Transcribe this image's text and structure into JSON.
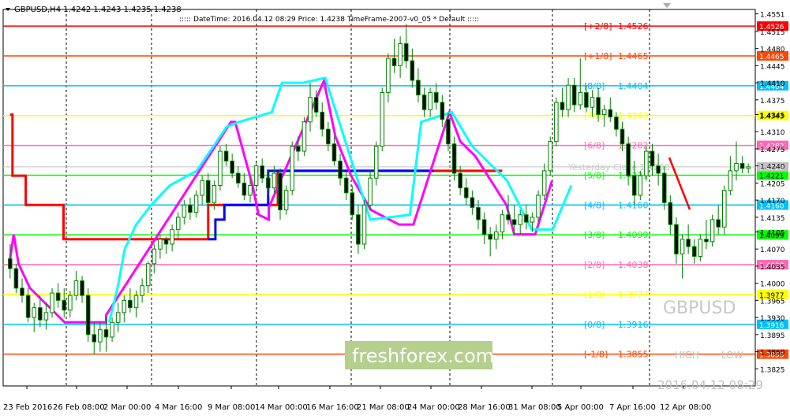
{
  "header": {
    "symbol_line": "GBPUSD,H4  1.4242 1.4243 1.4235 1.4238",
    "info_line": "::::: DateTime: 2016.04.12 08:29   Price: 1.4238   TimeFrame-2007-v0_05    *   Default   :::::"
  },
  "watermark": {
    "symbol": "GBPUSD",
    "brand": "freshforex.com",
    "high_label": "HIGH",
    "low_label": "LOW",
    "timestamp": "2016.04.12 08:29"
  },
  "colors": {
    "candle": "#008000",
    "background": "#ffffff",
    "red_line": "#ff0000",
    "magenta_line": "#ff00ff",
    "cyan_line": "#00ffff",
    "blue_line": "#0000ff",
    "grid": "#000000"
  },
  "chart_data": {
    "type": "candlestick",
    "symbol": "GBPUSD",
    "timeframe": "H4",
    "ylim": [
      1.379,
      1.456
    ],
    "y_ticks": [
      "1.4551",
      "1.4515",
      "1.4480",
      "1.4445",
      "1.4410",
      "1.4375",
      "1.4345",
      "1.4310",
      "1.4275",
      "1.4240",
      "1.4205",
      "1.4170",
      "1.4135",
      "1.4105",
      "1.4070",
      "1.4035",
      "1.4000",
      "1.3965",
      "1.3930",
      "1.3895",
      "1.3860",
      "1.3825"
    ],
    "x_ticks": [
      "23 Feb 2016",
      "26 Feb 08:00",
      "2 Mar 00:00",
      "4 Mar 16:00",
      "9 Mar 08:00",
      "14 Mar 00:00",
      "16 Mar 16:00",
      "21 Mar 08:00",
      "24 Mar 00:00",
      "28 Mar 16:00",
      "31 Mar 08:00",
      "5 Apr 00:00",
      "7 Apr 16:00",
      "12 Apr 08:00"
    ],
    "last_price": {
      "label": "1.4238",
      "value": 1.4238
    },
    "murrey_levels": [
      {
        "name": "[+2/8]",
        "value": 1.4526,
        "label": "1.4526",
        "color": "#ff0000"
      },
      {
        "name": "[+1/8]",
        "value": 1.4465,
        "label": "1.4465",
        "color": "#ff4500"
      },
      {
        "name": "[8/8]",
        "value": 1.4404,
        "label": "1.4404",
        "color": "#00bfff"
      },
      {
        "name": "[7/8]",
        "value": 1.4343,
        "label": "1.4343",
        "color": "#ffff00"
      },
      {
        "name": "[6/8]",
        "value": 1.4282,
        "label": "1.4282",
        "color": "#ff69b4"
      },
      {
        "name": "[5/8]",
        "value": 1.4221,
        "label": "1.4221",
        "color": "#00ff00"
      },
      {
        "name": "[4/8]",
        "value": 1.416,
        "label": "1.4160",
        "color": "#00bfff"
      },
      {
        "name": "[3/8]",
        "value": 1.4099,
        "label": "1.4099",
        "color": "#00ff00"
      },
      {
        "name": "[2/8]",
        "value": 1.4038,
        "label": "1.4038",
        "color": "#ff69b4"
      },
      {
        "name": "[1/8]",
        "value": 1.3977,
        "label": "1.3977",
        "color": "#ffff00"
      },
      {
        "name": "[0/8]",
        "value": 1.3916,
        "label": "1.3916",
        "color": "#00bfff"
      },
      {
        "name": "[-1/8]",
        "value": 1.3855,
        "label": "1.3855",
        "color": "#ff4500"
      }
    ],
    "yesterday_close_label": "Yesterday Close 1.4238",
    "candles": [
      {
        "o": 1.405,
        "h": 1.408,
        "l": 1.401,
        "c": 1.403
      },
      {
        "o": 1.403,
        "h": 1.404,
        "l": 1.398,
        "c": 1.399
      },
      {
        "o": 1.399,
        "h": 1.401,
        "l": 1.396,
        "c": 1.3975
      },
      {
        "o": 1.3975,
        "h": 1.399,
        "l": 1.392,
        "c": 1.393
      },
      {
        "o": 1.393,
        "h": 1.396,
        "l": 1.39,
        "c": 1.395
      },
      {
        "o": 1.395,
        "h": 1.3975,
        "l": 1.391,
        "c": 1.3925
      },
      {
        "o": 1.3925,
        "h": 1.396,
        "l": 1.3905,
        "c": 1.394
      },
      {
        "o": 1.394,
        "h": 1.399,
        "l": 1.393,
        "c": 1.398
      },
      {
        "o": 1.398,
        "h": 1.4,
        "l": 1.395,
        "c": 1.3965
      },
      {
        "o": 1.3965,
        "h": 1.399,
        "l": 1.393,
        "c": 1.3945
      },
      {
        "o": 1.3945,
        "h": 1.3985,
        "l": 1.393,
        "c": 1.3975
      },
      {
        "o": 1.3975,
        "h": 1.4025,
        "l": 1.3965,
        "c": 1.4005
      },
      {
        "o": 1.4005,
        "h": 1.4015,
        "l": 1.396,
        "c": 1.3975
      },
      {
        "o": 1.3975,
        "h": 1.399,
        "l": 1.388,
        "c": 1.3895
      },
      {
        "o": 1.3895,
        "h": 1.392,
        "l": 1.3855,
        "c": 1.388
      },
      {
        "o": 1.388,
        "h": 1.392,
        "l": 1.386,
        "c": 1.3905
      },
      {
        "o": 1.3905,
        "h": 1.393,
        "l": 1.386,
        "c": 1.389
      },
      {
        "o": 1.389,
        "h": 1.393,
        "l": 1.388,
        "c": 1.392
      },
      {
        "o": 1.392,
        "h": 1.396,
        "l": 1.39,
        "c": 1.394
      },
      {
        "o": 1.394,
        "h": 1.3975,
        "l": 1.392,
        "c": 1.3965
      },
      {
        "o": 1.3965,
        "h": 1.399,
        "l": 1.394,
        "c": 1.395
      },
      {
        "o": 1.395,
        "h": 1.3985,
        "l": 1.393,
        "c": 1.3975
      },
      {
        "o": 1.3975,
        "h": 1.401,
        "l": 1.396,
        "c": 1.3995
      },
      {
        "o": 1.3995,
        "h": 1.4045,
        "l": 1.398,
        "c": 1.404
      },
      {
        "o": 1.404,
        "h": 1.408,
        "l": 1.402,
        "c": 1.407
      },
      {
        "o": 1.407,
        "h": 1.41,
        "l": 1.405,
        "c": 1.409
      },
      {
        "o": 1.409,
        "h": 1.4095,
        "l": 1.406,
        "c": 1.408
      },
      {
        "o": 1.408,
        "h": 1.412,
        "l": 1.4065,
        "c": 1.411
      },
      {
        "o": 1.411,
        "h": 1.4145,
        "l": 1.409,
        "c": 1.4135
      },
      {
        "o": 1.4135,
        "h": 1.417,
        "l": 1.412,
        "c": 1.416
      },
      {
        "o": 1.416,
        "h": 1.4175,
        "l": 1.413,
        "c": 1.4145
      },
      {
        "o": 1.4145,
        "h": 1.419,
        "l": 1.4135,
        "c": 1.418
      },
      {
        "o": 1.418,
        "h": 1.422,
        "l": 1.416,
        "c": 1.421
      },
      {
        "o": 1.421,
        "h": 1.4225,
        "l": 1.415,
        "c": 1.4165
      },
      {
        "o": 1.4165,
        "h": 1.421,
        "l": 1.415,
        "c": 1.42
      },
      {
        "o": 1.42,
        "h": 1.428,
        "l": 1.419,
        "c": 1.427
      },
      {
        "o": 1.427,
        "h": 1.4285,
        "l": 1.424,
        "c": 1.425
      },
      {
        "o": 1.425,
        "h": 1.4265,
        "l": 1.4215,
        "c": 1.4225
      },
      {
        "o": 1.4225,
        "h": 1.424,
        "l": 1.4195,
        "c": 1.4205
      },
      {
        "o": 1.4205,
        "h": 1.4225,
        "l": 1.417,
        "c": 1.418
      },
      {
        "o": 1.418,
        "h": 1.4215,
        "l": 1.4165,
        "c": 1.42
      },
      {
        "o": 1.42,
        "h": 1.425,
        "l": 1.419,
        "c": 1.424
      },
      {
        "o": 1.424,
        "h": 1.4255,
        "l": 1.4205,
        "c": 1.4215
      },
      {
        "o": 1.4215,
        "h": 1.423,
        "l": 1.418,
        "c": 1.4195
      },
      {
        "o": 1.4195,
        "h": 1.424,
        "l": 1.4185,
        "c": 1.4225
      },
      {
        "o": 1.4225,
        "h": 1.4235,
        "l": 1.413,
        "c": 1.415
      },
      {
        "o": 1.415,
        "h": 1.42,
        "l": 1.414,
        "c": 1.419
      },
      {
        "o": 1.419,
        "h": 1.429,
        "l": 1.418,
        "c": 1.428
      },
      {
        "o": 1.428,
        "h": 1.43,
        "l": 1.425,
        "c": 1.427
      },
      {
        "o": 1.427,
        "h": 1.434,
        "l": 1.426,
        "c": 1.433
      },
      {
        "o": 1.433,
        "h": 1.441,
        "l": 1.431,
        "c": 1.438
      },
      {
        "o": 1.438,
        "h": 1.4395,
        "l": 1.434,
        "c": 1.435
      },
      {
        "o": 1.435,
        "h": 1.437,
        "l": 1.43,
        "c": 1.4315
      },
      {
        "o": 1.4315,
        "h": 1.433,
        "l": 1.427,
        "c": 1.4285
      },
      {
        "o": 1.4285,
        "h": 1.43,
        "l": 1.424,
        "c": 1.425
      },
      {
        "o": 1.425,
        "h": 1.4265,
        "l": 1.42,
        "c": 1.4215
      },
      {
        "o": 1.4215,
        "h": 1.423,
        "l": 1.417,
        "c": 1.4185
      },
      {
        "o": 1.4185,
        "h": 1.42,
        "l": 1.413,
        "c": 1.414
      },
      {
        "o": 1.414,
        "h": 1.416,
        "l": 1.406,
        "c": 1.408
      },
      {
        "o": 1.408,
        "h": 1.417,
        "l": 1.407,
        "c": 1.416
      },
      {
        "o": 1.416,
        "h": 1.423,
        "l": 1.415,
        "c": 1.4215
      },
      {
        "o": 1.4215,
        "h": 1.429,
        "l": 1.42,
        "c": 1.428
      },
      {
        "o": 1.428,
        "h": 1.44,
        "l": 1.427,
        "c": 1.439
      },
      {
        "o": 1.439,
        "h": 1.447,
        "l": 1.437,
        "c": 1.446
      },
      {
        "o": 1.446,
        "h": 1.45,
        "l": 1.443,
        "c": 1.4445
      },
      {
        "o": 1.4445,
        "h": 1.4505,
        "l": 1.442,
        "c": 1.449
      },
      {
        "o": 1.449,
        "h": 1.453,
        "l": 1.444,
        "c": 1.4455
      },
      {
        "o": 1.4455,
        "h": 1.448,
        "l": 1.44,
        "c": 1.4415
      },
      {
        "o": 1.4415,
        "h": 1.444,
        "l": 1.437,
        "c": 1.4385
      },
      {
        "o": 1.4385,
        "h": 1.44,
        "l": 1.434,
        "c": 1.4355
      },
      {
        "o": 1.4355,
        "h": 1.44,
        "l": 1.434,
        "c": 1.439
      },
      {
        "o": 1.439,
        "h": 1.441,
        "l": 1.4355,
        "c": 1.437
      },
      {
        "o": 1.437,
        "h": 1.4385,
        "l": 1.432,
        "c": 1.4335
      },
      {
        "o": 1.4335,
        "h": 1.435,
        "l": 1.427,
        "c": 1.4285
      },
      {
        "o": 1.4285,
        "h": 1.43,
        "l": 1.421,
        "c": 1.4225
      },
      {
        "o": 1.4225,
        "h": 1.424,
        "l": 1.418,
        "c": 1.4195
      },
      {
        "o": 1.4195,
        "h": 1.4215,
        "l": 1.416,
        "c": 1.4175
      },
      {
        "o": 1.4175,
        "h": 1.419,
        "l": 1.414,
        "c": 1.4155
      },
      {
        "o": 1.4155,
        "h": 1.417,
        "l": 1.411,
        "c": 1.413
      },
      {
        "o": 1.413,
        "h": 1.4145,
        "l": 1.408,
        "c": 1.41
      },
      {
        "o": 1.41,
        "h": 1.4115,
        "l": 1.4055,
        "c": 1.409
      },
      {
        "o": 1.409,
        "h": 1.412,
        "l": 1.407,
        "c": 1.4105
      },
      {
        "o": 1.4105,
        "h": 1.415,
        "l": 1.409,
        "c": 1.414
      },
      {
        "o": 1.414,
        "h": 1.418,
        "l": 1.412,
        "c": 1.413
      },
      {
        "o": 1.413,
        "h": 1.416,
        "l": 1.41,
        "c": 1.412
      },
      {
        "o": 1.412,
        "h": 1.415,
        "l": 1.41,
        "c": 1.414
      },
      {
        "o": 1.414,
        "h": 1.416,
        "l": 1.411,
        "c": 1.4125
      },
      {
        "o": 1.4125,
        "h": 1.4145,
        "l": 1.4105,
        "c": 1.4135
      },
      {
        "o": 1.4135,
        "h": 1.419,
        "l": 1.4125,
        "c": 1.418
      },
      {
        "o": 1.418,
        "h": 1.4245,
        "l": 1.417,
        "c": 1.423
      },
      {
        "o": 1.423,
        "h": 1.43,
        "l": 1.422,
        "c": 1.429
      },
      {
        "o": 1.429,
        "h": 1.438,
        "l": 1.428,
        "c": 1.437
      },
      {
        "o": 1.437,
        "h": 1.44,
        "l": 1.434,
        "c": 1.4355
      },
      {
        "o": 1.4355,
        "h": 1.442,
        "l": 1.434,
        "c": 1.4405
      },
      {
        "o": 1.4405,
        "h": 1.442,
        "l": 1.435,
        "c": 1.4365
      },
      {
        "o": 1.4365,
        "h": 1.446,
        "l": 1.4355,
        "c": 1.439
      },
      {
        "o": 1.439,
        "h": 1.4405,
        "l": 1.435,
        "c": 1.436
      },
      {
        "o": 1.436,
        "h": 1.4395,
        "l": 1.434,
        "c": 1.438
      },
      {
        "o": 1.438,
        "h": 1.44,
        "l": 1.433,
        "c": 1.4345
      },
      {
        "o": 1.4345,
        "h": 1.4365,
        "l": 1.432,
        "c": 1.4355
      },
      {
        "o": 1.4355,
        "h": 1.438,
        "l": 1.433,
        "c": 1.434
      },
      {
        "o": 1.434,
        "h": 1.435,
        "l": 1.43,
        "c": 1.4315
      },
      {
        "o": 1.4315,
        "h": 1.433,
        "l": 1.427,
        "c": 1.4285
      },
      {
        "o": 1.4285,
        "h": 1.43,
        "l": 1.42,
        "c": 1.422
      },
      {
        "o": 1.422,
        "h": 1.425,
        "l": 1.416,
        "c": 1.418
      },
      {
        "o": 1.418,
        "h": 1.423,
        "l": 1.417,
        "c": 1.422
      },
      {
        "o": 1.422,
        "h": 1.428,
        "l": 1.421,
        "c": 1.427
      },
      {
        "o": 1.427,
        "h": 1.4285,
        "l": 1.422,
        "c": 1.424
      },
      {
        "o": 1.424,
        "h": 1.4265,
        "l": 1.42,
        "c": 1.4225
      },
      {
        "o": 1.4225,
        "h": 1.424,
        "l": 1.415,
        "c": 1.4165
      },
      {
        "o": 1.4165,
        "h": 1.418,
        "l": 1.41,
        "c": 1.412
      },
      {
        "o": 1.412,
        "h": 1.4135,
        "l": 1.404,
        "c": 1.406
      },
      {
        "o": 1.406,
        "h": 1.41,
        "l": 1.401,
        "c": 1.409
      },
      {
        "o": 1.409,
        "h": 1.412,
        "l": 1.406,
        "c": 1.4075
      },
      {
        "o": 1.4075,
        "h": 1.409,
        "l": 1.404,
        "c": 1.4055
      },
      {
        "o": 1.4055,
        "h": 1.41,
        "l": 1.4045,
        "c": 1.409
      },
      {
        "o": 1.409,
        "h": 1.413,
        "l": 1.407,
        "c": 1.4085
      },
      {
        "o": 1.4085,
        "h": 1.414,
        "l": 1.4075,
        "c": 1.413
      },
      {
        "o": 1.413,
        "h": 1.416,
        "l": 1.41,
        "c": 1.4115
      },
      {
        "o": 1.4115,
        "h": 1.42,
        "l": 1.41,
        "c": 1.419
      },
      {
        "o": 1.419,
        "h": 1.426,
        "l": 1.418,
        "c": 1.423
      },
      {
        "o": 1.423,
        "h": 1.429,
        "l": 1.421,
        "c": 1.4245
      },
      {
        "o": 1.4245,
        "h": 1.426,
        "l": 1.4225,
        "c": 1.4235
      },
      {
        "o": 1.4235,
        "h": 1.4245,
        "l": 1.4225,
        "c": 1.4238
      }
    ]
  },
  "_overlay": {
    "red_steps": [
      [
        0,
        1.4345
      ],
      [
        0.4,
        1.4345
      ],
      [
        0.4,
        1.422
      ],
      [
        2.6,
        1.422
      ],
      [
        2.6,
        1.416
      ],
      [
        8.9,
        1.416
      ],
      [
        8.9,
        1.409
      ],
      [
        33.0,
        1.409
      ],
      [
        33.0,
        1.416
      ],
      [
        44.6,
        1.416
      ],
      [
        44.6,
        1.423
      ],
      [
        50.3,
        1.423
      ],
      [
        50.3,
        1.423
      ],
      [
        82.0,
        1.423
      ]
    ],
    "blue_steps": [
      [
        33.0,
        1.409
      ],
      [
        34.2,
        1.409
      ],
      [
        34.2,
        1.413
      ],
      [
        35.7,
        1.413
      ],
      [
        35.7,
        1.416
      ],
      [
        43.0,
        1.416
      ],
      [
        43.0,
        1.423
      ],
      [
        45.8,
        1.423
      ],
      [
        66.0,
        1.423
      ],
      [
        70.6,
        1.423
      ]
    ],
    "magenta_steps": [
      [
        0.0,
        1.405
      ],
      [
        0.6,
        1.41
      ],
      [
        1.4,
        1.404
      ],
      [
        3.3,
        1.399
      ],
      [
        9.1,
        1.392
      ],
      [
        16.0,
        1.392
      ],
      [
        16.0,
        1.3935
      ],
      [
        36.8,
        1.433
      ],
      [
        37.5,
        1.433
      ],
      [
        40.4,
        1.42
      ],
      [
        41.4,
        1.414
      ],
      [
        43.1,
        1.413
      ],
      [
        43.1,
        1.4155
      ],
      [
        52.5,
        1.442
      ],
      [
        52.5,
        1.44
      ],
      [
        54.2,
        1.43
      ],
      [
        56.8,
        1.422
      ],
      [
        60.1,
        1.415
      ],
      [
        64.8,
        1.412
      ],
      [
        67.2,
        1.412
      ],
      [
        73.2,
        1.435
      ],
      [
        75.0,
        1.429
      ],
      [
        77.5,
        1.426
      ],
      [
        82.7,
        1.416
      ],
      [
        84.0,
        1.41
      ],
      [
        87.5,
        1.41
      ],
      [
        90.3,
        1.421
      ]
    ],
    "cyan_steps": [
      [
        16.5,
        1.392
      ],
      [
        17.9,
        1.399
      ],
      [
        19.1,
        1.407
      ],
      [
        21.0,
        1.412
      ],
      [
        23.5,
        1.416
      ],
      [
        26.6,
        1.42
      ],
      [
        31.1,
        1.423
      ],
      [
        36.1,
        1.432
      ],
      [
        38.2,
        1.433
      ],
      [
        43.6,
        1.435
      ],
      [
        45.3,
        1.441
      ],
      [
        48.8,
        1.441
      ],
      [
        52.5,
        1.442
      ],
      [
        60.0,
        1.413
      ],
      [
        66.6,
        1.414
      ],
      [
        68.5,
        1.433
      ],
      [
        73.6,
        1.435
      ],
      [
        77.0,
        1.428
      ],
      [
        82.8,
        1.421
      ],
      [
        86.9,
        1.411
      ],
      [
        90.4,
        1.411
      ],
      [
        93.5,
        1.42
      ]
    ]
  }
}
